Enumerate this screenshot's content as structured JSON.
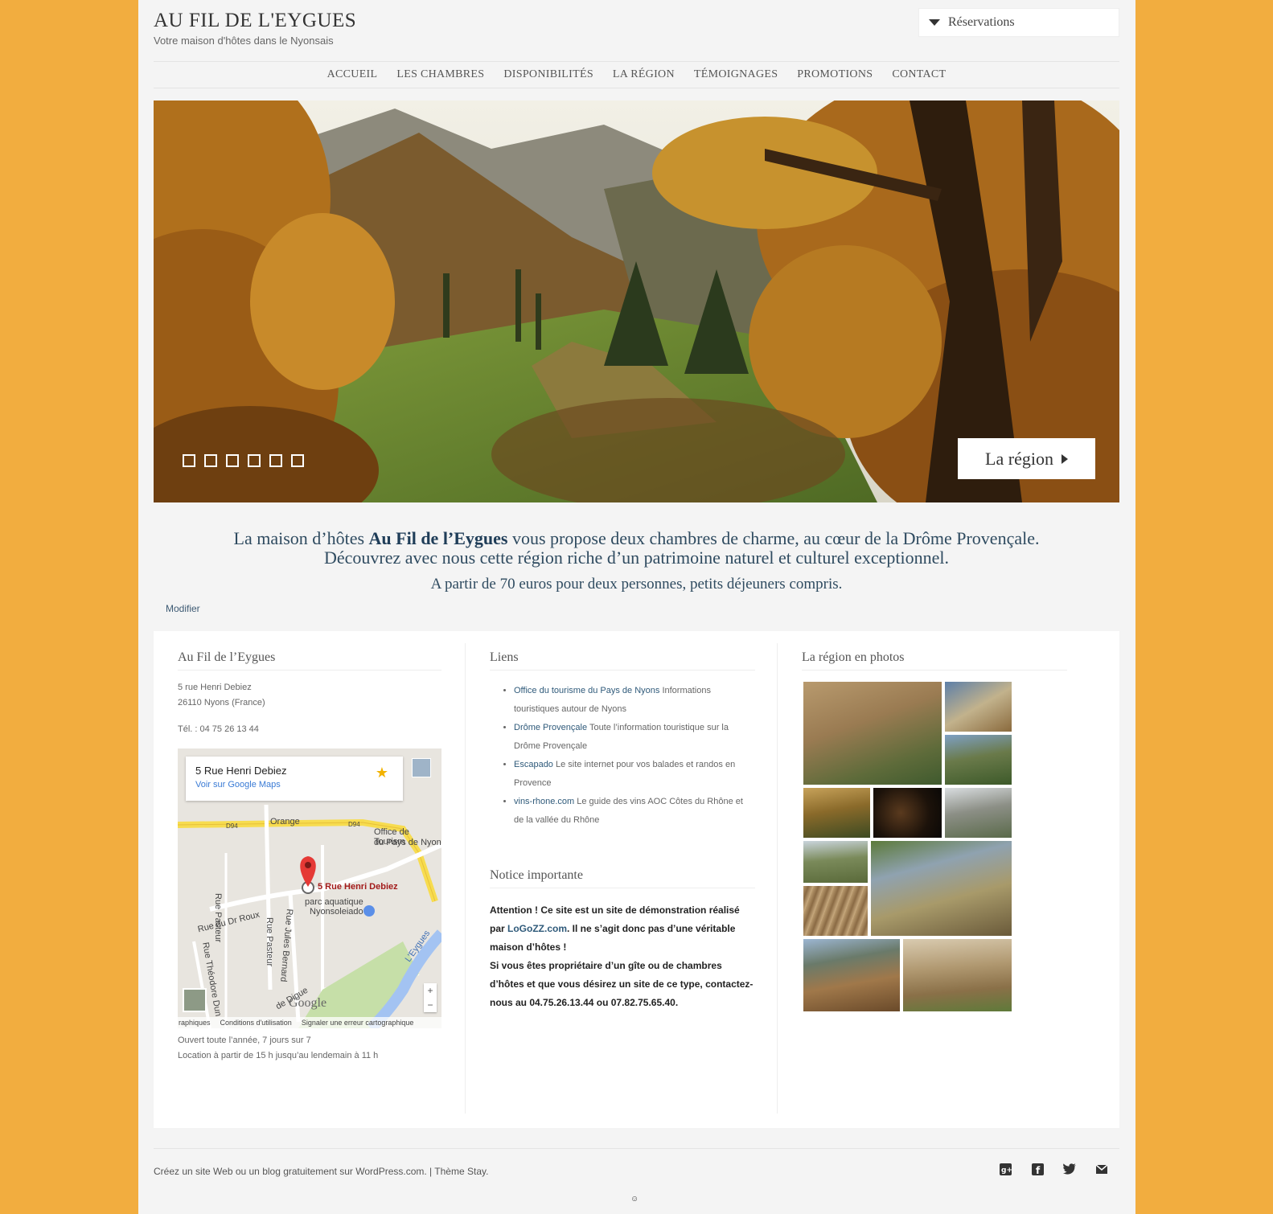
{
  "header": {
    "site_title": "AU FIL DE L'EYGUES",
    "site_description": "Votre maison d'hôtes dans le Nyonsais",
    "reservations_label": "Réservations"
  },
  "nav": {
    "items": [
      "ACCUEIL",
      "LES CHAMBRES",
      "DISPONIBILITÉS",
      "LA RÉGION",
      "TÉMOIGNAGES",
      "PROMOTIONS",
      "CONTACT"
    ]
  },
  "hero": {
    "slide_count": 6,
    "button_label": "La région"
  },
  "intro": {
    "line1_before": "La maison d’hôtes ",
    "line1_bold": "Au Fil de l’Eygues",
    "line1_after": " vous propose deux chambres de charme, au cœur de la Drôme Provençale.",
    "line2": "Découvrez avec nous cette région riche d’un patrimoine naturel et culturel exceptionnel.",
    "line3": "A partir de 70 euros pour deux personnes, petits déjeuners compris.",
    "edit_label": "Modifier"
  },
  "widget_contact": {
    "title": "Au Fil de l’Eygues",
    "address_line1": "5 rue Henri Debiez",
    "address_line2": "26110 Nyons (France)",
    "phone": "Tél. : 04 75 26 13 44",
    "map": {
      "card_title": "5 Rue Henri Debiez",
      "card_link": "Voir sur Google Maps",
      "labels": {
        "orange": "Orange",
        "office": "Office de Tourism",
        "office2": "du Pays de Nyon",
        "marker": "5 Rue Henri Debiez",
        "aqua1": "parc aquatique",
        "aqua2": "Nyonsoleiado",
        "rue_pasteur": "Rue Pasteur",
        "rue_pasteur2": "Rue Pasteur",
        "rue_roux": "Rue du Dr Roux",
        "rue_jules": "Rue Jules Bernard",
        "rue_theo": "Rue Théodore Dun",
        "eygues": "L'Eygues",
        "digue": "de Digue",
        "google": "Google",
        "d94a": "D94",
        "d94b": "D94"
      },
      "footer": [
        "raphiques",
        "Conditions d'utilisation",
        "Signaler une erreur cartographique"
      ]
    },
    "hours_line1": "Ouvert toute l’année, 7 jours sur 7",
    "hours_line2": "Location à partir de 15 h jusqu’au lendemain à 11 h"
  },
  "widget_links": {
    "title": "Liens",
    "items": [
      {
        "link": "Office du tourisme du Pays de Nyons",
        "desc": " Informations touristiques autour de Nyons"
      },
      {
        "link": "Drôme Provençale",
        "desc": " Toute l’information touristique sur la Drôme Provençale"
      },
      {
        "link": "Escapado",
        "desc": " Le site internet pour vos balades et randos en Provence"
      },
      {
        "link": "vins-rhone.com",
        "desc": " Le guide des vins AOC Côtes du Rhône et de la vallée du Rhône"
      }
    ]
  },
  "widget_notice": {
    "title": "Notice importante",
    "text1": "Attention ! Ce site est un site de démonstration réalisé par ",
    "link": "LoGoZZ.com",
    "text2": ". Il ne s’agit donc pas d’une véritable maison d’hôtes !",
    "text3": "Si vous êtes propriétaire d’un gîte ou de chambres d’hôtes et que vous désirez un site de ce type, contactez-nous au 04.75.26.13.44 ou 07.82.75.65.40."
  },
  "widget_photos": {
    "title": "La région en photos"
  },
  "footer": {
    "credit_link": "Créez un site Web ou un blog gratuitement sur WordPress.com.",
    "separator": " | ",
    "theme_link": "Thème Stay.",
    "social": [
      "google-plus-icon",
      "facebook-icon",
      "twitter-icon",
      "email-icon"
    ]
  },
  "colors": {
    "page_background": "#f2ad3f",
    "content_background": "#f4f4f4",
    "intro_text": "#2f4b60"
  }
}
